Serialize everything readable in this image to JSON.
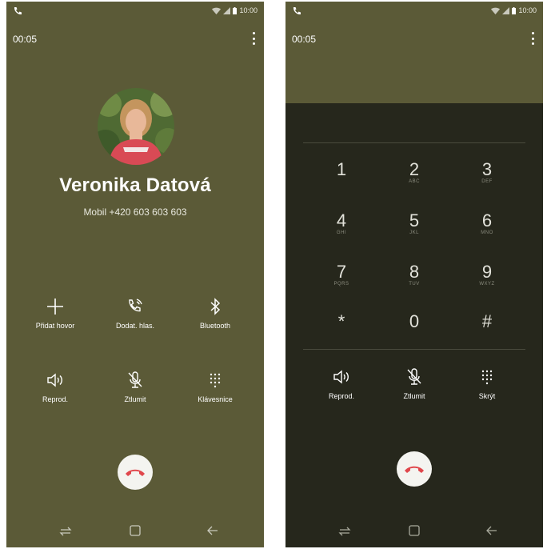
{
  "status_bar": {
    "time": "10:00"
  },
  "in_call": {
    "timer": "00:05",
    "caller_name": "Veronika Datová",
    "caller_number": "Mobil  +420 603 603 603",
    "actions": [
      {
        "label": "Přidat hovor",
        "icon": "add-call-icon"
      },
      {
        "label": "Dodat. hlas.",
        "icon": "extra-volume-icon"
      },
      {
        "label": "Bluetooth",
        "icon": "bluetooth-icon"
      },
      {
        "label": "Reprod.",
        "icon": "speaker-icon"
      },
      {
        "label": "Ztlumit",
        "icon": "mute-icon"
      },
      {
        "label": "Klávesnice",
        "icon": "keypad-icon"
      }
    ]
  },
  "dialpad_screen": {
    "timer": "00:05",
    "keys": [
      {
        "digit": "1",
        "letters": ""
      },
      {
        "digit": "2",
        "letters": "ABC"
      },
      {
        "digit": "3",
        "letters": "DEF"
      },
      {
        "digit": "4",
        "letters": "GHI"
      },
      {
        "digit": "5",
        "letters": "JKL"
      },
      {
        "digit": "6",
        "letters": "MNO"
      },
      {
        "digit": "7",
        "letters": "PQRS"
      },
      {
        "digit": "8",
        "letters": "TUV"
      },
      {
        "digit": "9",
        "letters": "WXYZ"
      },
      {
        "digit": "*",
        "letters": ""
      },
      {
        "digit": "0",
        "letters": ""
      },
      {
        "digit": "#",
        "letters": ""
      }
    ],
    "actions": [
      {
        "label": "Reprod.",
        "icon": "speaker-icon"
      },
      {
        "label": "Ztlumit",
        "icon": "mute-icon"
      },
      {
        "label": "Skrýt",
        "icon": "keypad-icon"
      }
    ]
  },
  "colors": {
    "call_background": "#5b5a37",
    "dialpad_background": "#26271c",
    "end_call_red": "#e0474c"
  }
}
